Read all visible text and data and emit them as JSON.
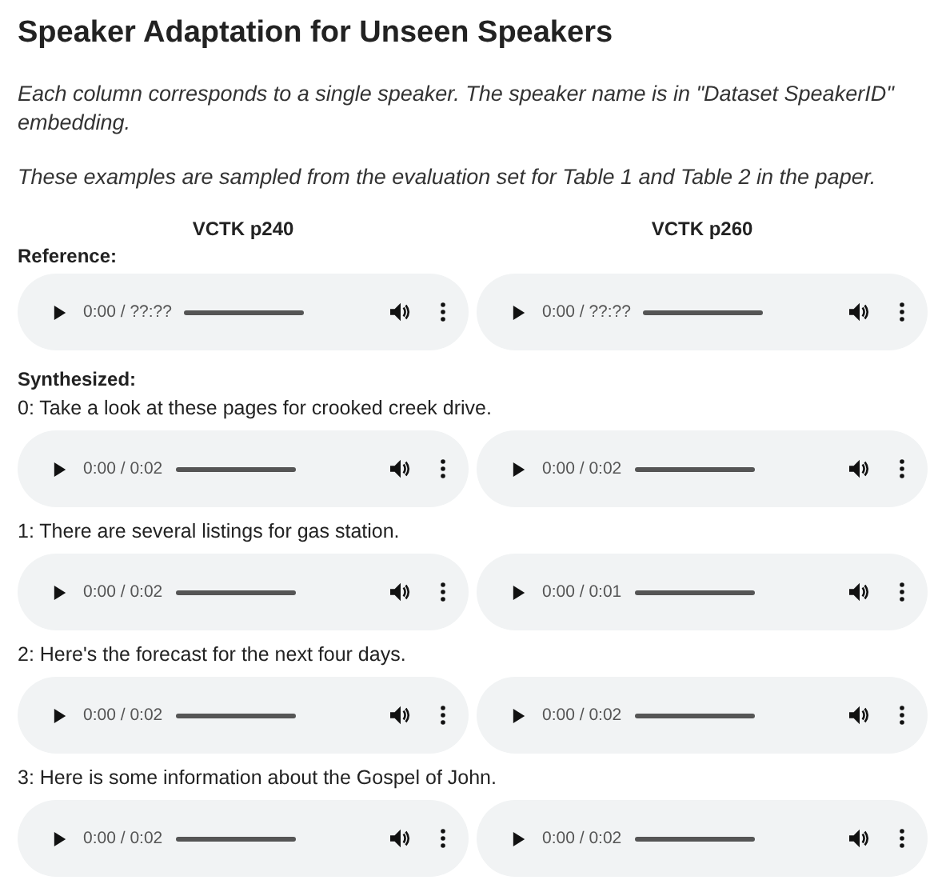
{
  "title": "Speaker Adaptation for Unseen Speakers",
  "paragraphs": [
    "Each column corresponds to a single speaker. The speaker name is in \"Dataset SpeakerID\" embedding.",
    "These examples are sampled from the evaluation set for Table 1 and Table 2 in the paper."
  ],
  "speakers": [
    "VCTK p240",
    "VCTK p260"
  ],
  "reference": {
    "label": "Reference:",
    "players": [
      {
        "time": "0:00 / ??:??",
        "level": 0
      },
      {
        "time": "0:00 / ??:??",
        "level": 0
      }
    ]
  },
  "synthesized": {
    "label": "Synthesized:",
    "items": [
      {
        "sentence": "0: Take a look at these pages for crooked creek drive.",
        "players": [
          {
            "time": "0:00 / 0:02",
            "level": 0
          },
          {
            "time": "0:00 / 0:02",
            "level": 0
          }
        ]
      },
      {
        "sentence": "1: There are several listings for gas station.",
        "players": [
          {
            "time": "0:00 / 0:02",
            "level": 0
          },
          {
            "time": "0:00 / 0:01",
            "level": 0
          }
        ]
      },
      {
        "sentence": "2: Here's the forecast for the next four days.",
        "players": [
          {
            "time": "0:00 / 0:02",
            "level": 0
          },
          {
            "time": "0:00 / 0:02",
            "level": 0
          }
        ]
      },
      {
        "sentence": "3: Here is some information about the Gospel of John.",
        "players": [
          {
            "time": "0:00 / 0:02",
            "level": 0
          },
          {
            "time": "0:00 / 0:02",
            "level": 0
          }
        ]
      }
    ]
  }
}
